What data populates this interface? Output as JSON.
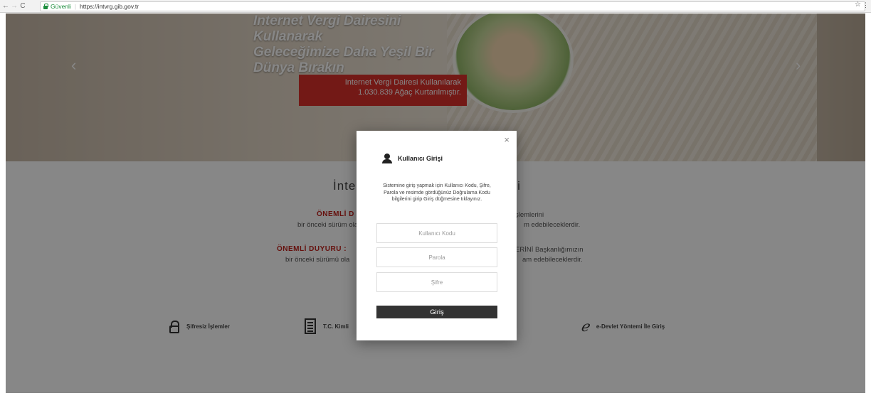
{
  "browser": {
    "back_icon": "arrow-left-icon",
    "forward_icon": "arrow-right-icon",
    "reload_icon": "reload-icon",
    "secure_label": "Güvenli",
    "url": "https://intvrg.gib.gov.tr",
    "bookmark_icon": "star-icon",
    "menu_icon": "menu-dots-icon"
  },
  "hero": {
    "title_line1": "Internet Vergi Dairesini Kullanarak",
    "title_line2": "Geleceğimize Daha Yeşil Bir",
    "title_line3": "Dünya Bırakın",
    "counter_line1": "Internet Vergi Dairesi Kullanılarak",
    "counter_line2": "1.030.839 Ağaç Kurtarılmıştır."
  },
  "content": {
    "title_left": "İnte",
    "title_right": "eri",
    "notice1_label": "ÖNEMLİ D",
    "notice1_text_left": "bir önceki sürüm ola",
    "notice1_text_right1": "şlemlerini",
    "notice1_text_right2": "m edebileceklerdir.",
    "notice2_label": "ÖNEMLİ DUYURU :",
    "notice2_text_left": "bir önceki sürümü ola",
    "notice2_text_right1": "ERİNİ Başkanlığımızın",
    "notice2_text_right2": "am edebileceklerdir."
  },
  "tiles": {
    "no_password": "Şifresiz İşlemler",
    "tc_id": "T.C. Kimli",
    "edevlet": "e-Devlet Yöntemi İle Giriş"
  },
  "modal": {
    "title": "Kullanıcı Girişi",
    "description": "Sistemine giriş yapmak için Kullanıcı Kodu, Şifre, Parola ve resimde gördüğünüz Doğrulama Kodu bilgilerini girip Giriş düğmesine tıklayınız.",
    "close_symbol": "×",
    "username_placeholder": "Kullanıcı Kodu",
    "password_placeholder": "Parola",
    "pin_placeholder": "Şifre",
    "login_label": "Giriş"
  }
}
